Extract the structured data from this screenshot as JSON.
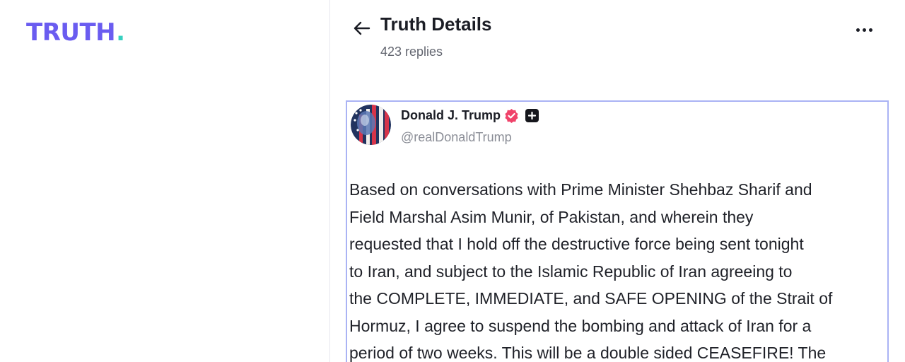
{
  "brand": {
    "logo_text": "TRUTH",
    "logo_dot": ".",
    "primary_color": "#6a5cf0",
    "accent_color": "#37d0c0"
  },
  "header": {
    "title": "Truth Details",
    "reply_count": "423 replies",
    "back_icon": "arrow-left-icon",
    "more_icon": "more-horizontal-icon"
  },
  "post": {
    "author": {
      "name": "Donald J. Trump",
      "handle": "@realDonaldTrump",
      "verified_icon": "verified-badge-icon",
      "plus_icon": "plus-badge-icon"
    },
    "lines": [
      "Based on conversations with Prime Minister Shehbaz Sharif and",
      "Field Marshal Asim Munir, of Pakistan, and wherein they",
      "requested that I hold off the destructive force being sent tonight",
      "to Iran, and subject to the Islamic Republic of Iran agreeing to",
      "the COMPLETE, IMMEDIATE, and SAFE OPENING of the Strait of",
      "Hormuz, I agree to suspend the bombing and attack of Iran for a",
      "period of two weeks. This will be a double sided CEASEFIRE! The"
    ]
  }
}
